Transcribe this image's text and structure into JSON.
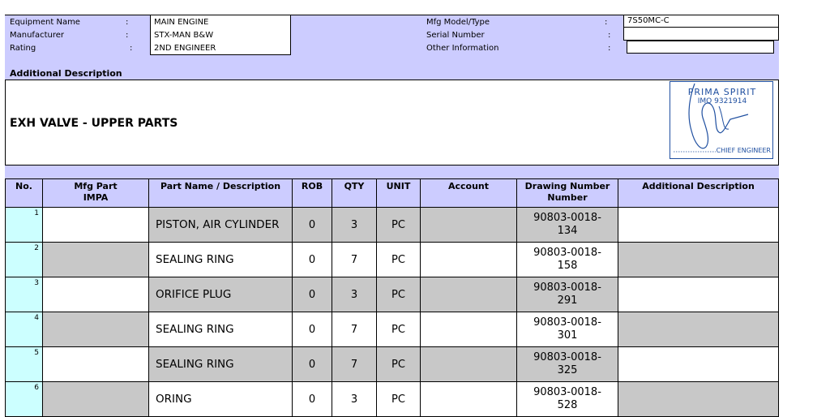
{
  "header": {
    "labels_left": [
      "Equipment Name",
      "Manufacturer",
      "Rating"
    ],
    "values_left": [
      "MAIN ENGINE",
      "STX-MAN B&W",
      "2ND ENGINEER"
    ],
    "labels_right": [
      "Mfg Model/Type",
      "Serial Number",
      "Other Information"
    ],
    "values_right": [
      "7S50MC-C",
      "",
      ""
    ],
    "colon": ":"
  },
  "additional": {
    "label": "Additional Description",
    "title": "EXH VALVE - UPPER PARTS",
    "stamp": {
      "line1": "PRIMA SPIRIT",
      "line2": "IMO 9321914",
      "line3": "CHIEF ENGINEER"
    }
  },
  "table": {
    "headers": [
      "No.",
      "Mfg Part IMPA",
      "Part Name / Description",
      "ROB",
      "QTY",
      "UNIT",
      "Account",
      "Drawing Number Number",
      "Additional Description"
    ],
    "rows": [
      {
        "no": "1",
        "name": "PISTON, AIR CYLINDER",
        "rob": "0",
        "qty": "3",
        "unit": "PC",
        "dwg1": "90803-0018-",
        "dwg2": "134"
      },
      {
        "no": "2",
        "name": "SEALING RING",
        "rob": "0",
        "qty": "7",
        "unit": "PC",
        "dwg1": "90803-0018-",
        "dwg2": "158"
      },
      {
        "no": "3",
        "name": "ORIFICE PLUG",
        "rob": "0",
        "qty": "3",
        "unit": "PC",
        "dwg1": "90803-0018-",
        "dwg2": "291"
      },
      {
        "no": "4",
        "name": "SEALING RING",
        "rob": "0",
        "qty": "7",
        "unit": "PC",
        "dwg1": "90803-0018-",
        "dwg2": "301"
      },
      {
        "no": "5",
        "name": "SEALING RING",
        "rob": "0",
        "qty": "7",
        "unit": "PC",
        "dwg1": "90803-0018-",
        "dwg2": "325"
      },
      {
        "no": "6",
        "name": "ORING",
        "rob": "0",
        "qty": "3",
        "unit": "PC",
        "dwg1": "90803-0018-",
        "dwg2": "528"
      }
    ]
  },
  "colors": {
    "header_bg": "#ccccff",
    "no_bg": "#ccffff",
    "stripe": "#c8c8c8",
    "stamp": "#1f4fa0"
  }
}
